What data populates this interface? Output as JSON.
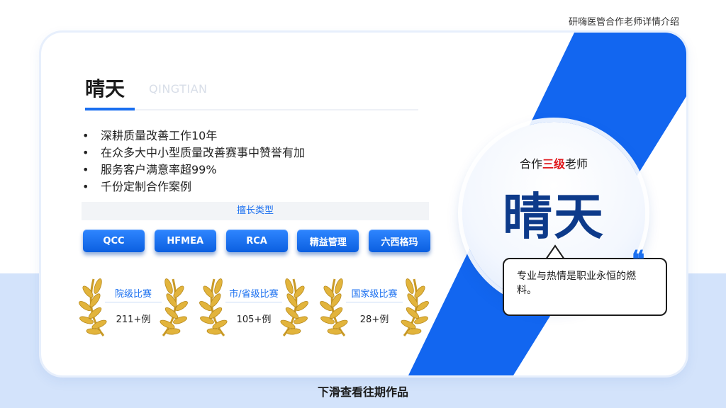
{
  "header": {
    "caption": "研嗨医管合作老师详情介绍"
  },
  "profile": {
    "name": "晴天",
    "name_en": "QINGTIAN",
    "bullets": [
      "深耕质量改善工作10年",
      "在众多大中小型质量改善赛事中赞誉有加",
      "服务客户满意率超99%",
      "千份定制合作案例"
    ]
  },
  "skills": {
    "header": "擅长类型",
    "tags": [
      "QCC",
      "HFMEA",
      "RCA",
      "精益管理",
      "六西格玛"
    ]
  },
  "awards": [
    {
      "label": "院级比赛",
      "count": "211+例"
    },
    {
      "label": "市/省级比赛",
      "count": "105+例"
    },
    {
      "label": "国家级比赛",
      "count": "28+例"
    }
  ],
  "badge": {
    "prefix": "合作",
    "level": "三级",
    "suffix": "老师",
    "name": "晴天"
  },
  "quote": {
    "text": "专业与热情是职业永恒的燃料。"
  },
  "footer": {
    "caption": "下滑查看往期作品"
  },
  "colors": {
    "accent": "#1a6ff0",
    "highlight": "#e0181c",
    "name_dark": "#0d3a8a",
    "band": "#d3e3fb",
    "laurel": "#e2b43c"
  }
}
